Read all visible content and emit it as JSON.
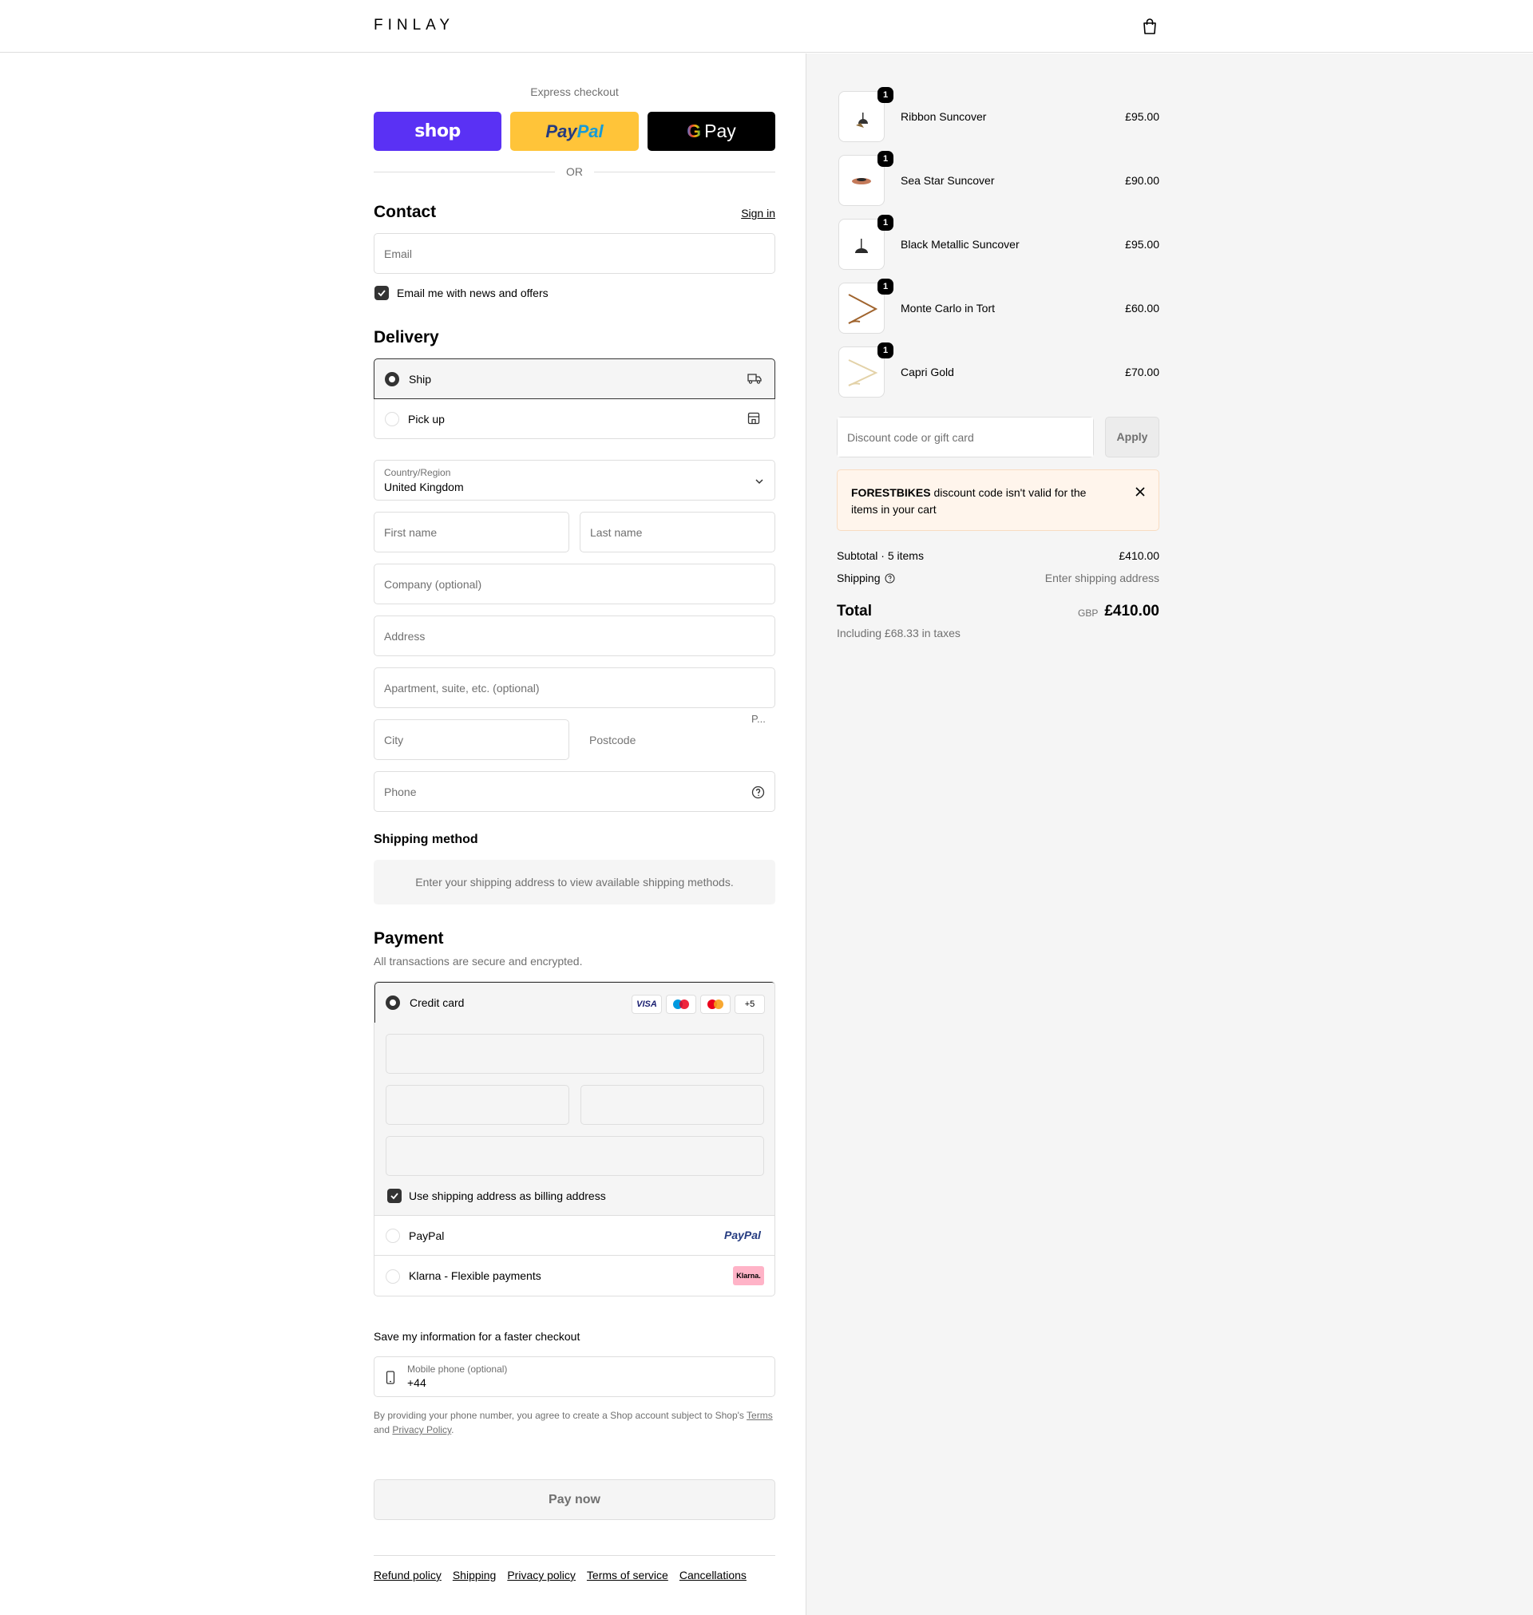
{
  "header": {
    "logo": "FINLAY",
    "cart_icon": "shopping-bag-icon"
  },
  "express": {
    "title": "Express checkout",
    "shop_label": "shop",
    "paypal_label_1": "Pay",
    "paypal_label_2": "Pal",
    "gpay_g": "G",
    "gpay_label": "Pay",
    "or": "OR"
  },
  "contact": {
    "title": "Contact",
    "sign_in": "Sign in",
    "email_placeholder": "Email",
    "newsletter_label": "Email me with news and offers"
  },
  "delivery": {
    "title": "Delivery",
    "ship_label": "Ship",
    "pickup_label": "Pick up",
    "country_caption": "Country/Region",
    "country_value": "United Kingdom",
    "first_name": "First name",
    "last_name": "Last name",
    "company": "Company (optional)",
    "address": "Address",
    "apartment": "Apartment, suite, etc. (optional)",
    "city": "City",
    "postcode": "Postcode",
    "postcode_hint": "P...",
    "phone": "Phone"
  },
  "shipping_method": {
    "title": "Shipping method",
    "message": "Enter your shipping address to view available shipping methods."
  },
  "payment": {
    "title": "Payment",
    "subtitle": "All transactions are secure and encrypted.",
    "credit_card_label": "Credit card",
    "visa": "VISA",
    "more_cards": "+5",
    "billing_label": "Use shipping address as billing address",
    "paypal_label": "PayPal",
    "paypal_logo": "PayPal",
    "klarna_label": "Klarna - Flexible payments",
    "klarna_logo": "Klarna."
  },
  "save_info": {
    "title": "Save my information for a faster checkout",
    "phone_caption": "Mobile phone (optional)",
    "phone_value": "+44",
    "legal_1": "By providing your phone number, you agree to create a Shop account subject to Shop's",
    "terms": "Terms",
    "legal_and": "and",
    "privacy": "Privacy Policy",
    "legal_end": "."
  },
  "pay_now": "Pay now",
  "footer": {
    "links": [
      "Refund policy",
      "Shipping",
      "Privacy policy",
      "Terms of service",
      "Cancellations"
    ]
  },
  "cart": {
    "items": [
      {
        "qty": "1",
        "name": "Ribbon Suncover",
        "price": "£95.00"
      },
      {
        "qty": "1",
        "name": "Sea Star Suncover",
        "price": "£90.00"
      },
      {
        "qty": "1",
        "name": "Black Metallic Suncover",
        "price": "£95.00"
      },
      {
        "qty": "1",
        "name": "Monte Carlo in Tort",
        "price": "£60.00"
      },
      {
        "qty": "1",
        "name": "Capri Gold",
        "price": "£70.00"
      }
    ],
    "discount_placeholder": "Discount code or gift card",
    "apply": "Apply",
    "warning_code": "FORESTBIKES",
    "warning_text": " discount code isn't valid for the items in your cart",
    "subtotal_label": "Subtotal · 5 items",
    "subtotal_value": "£410.00",
    "shipping_label": "Shipping",
    "shipping_value": "Enter shipping address",
    "total_label": "Total",
    "currency": "GBP",
    "total_value": "£410.00",
    "taxes": "Including £68.33 in taxes"
  }
}
